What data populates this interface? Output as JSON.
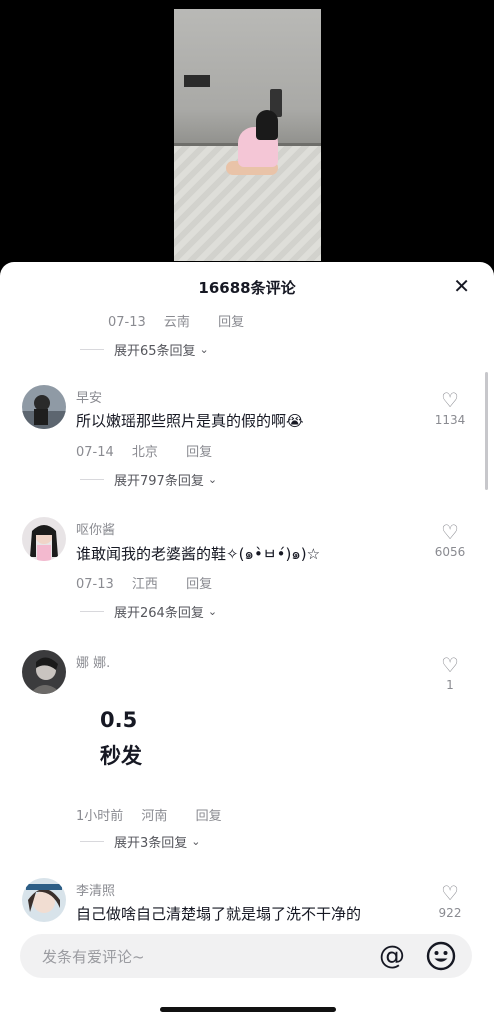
{
  "sheet": {
    "title": "16688条评论",
    "close_label": "✕"
  },
  "top_meta": {
    "date": "07-13",
    "location": "云南",
    "reply": "回复",
    "expand": "展开65条回复"
  },
  "comments": [
    {
      "username": "早安",
      "text": "所以嫩瑶那些照片是真的假的啊😭",
      "date": "07-14",
      "location": "北京",
      "reply": "回复",
      "likes": "1134",
      "expand": "展开797条回复"
    },
    {
      "username": "呕你酱",
      "text": "谁敢闻我的老婆酱的鞋✧(๑•̀ㅂ•́)๑)☆",
      "date": "07-13",
      "location": "江西",
      "reply": "回复",
      "likes": "6056",
      "expand": "展开264条回复"
    },
    {
      "username": "娜 娜.",
      "big_line1": "0.5",
      "big_line2": "秒发",
      "date": "1小时前",
      "location": "河南",
      "reply": "回复",
      "likes": "1",
      "expand": "展开3条回复"
    },
    {
      "username": "李清照",
      "text": "自己做啥自己清楚塌了就是塌了洗不干净的",
      "likes": "922"
    }
  ],
  "input": {
    "placeholder": "发条有爱评论~"
  },
  "icons": {
    "heart": "heart-icon",
    "at": "at-icon",
    "emoji": "emoji-icon",
    "chevron": "chevron-down-icon",
    "close": "close-icon"
  }
}
